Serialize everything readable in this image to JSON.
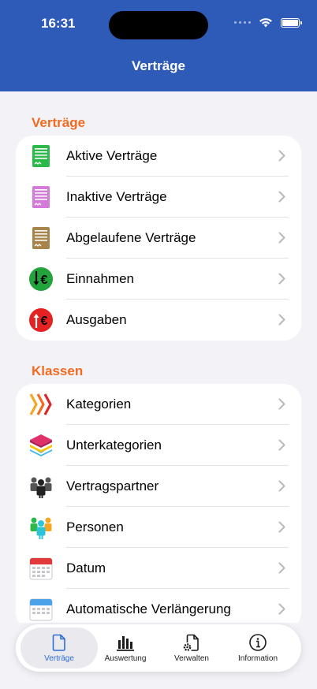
{
  "status_bar": {
    "time": "16:31"
  },
  "nav": {
    "title": "Verträge"
  },
  "sections": [
    {
      "header": "Verträge",
      "items": [
        {
          "label": "Aktive Verträge",
          "icon": "green-document-icon"
        },
        {
          "label": "Inaktive Verträge",
          "icon": "pink-document-icon"
        },
        {
          "label": "Abgelaufene Verträge",
          "icon": "brown-document-icon"
        },
        {
          "label": "Einnahmen",
          "icon": "income-euro-icon"
        },
        {
          "label": "Ausgaben",
          "icon": "expense-euro-icon"
        }
      ]
    },
    {
      "header": "Klassen",
      "items": [
        {
          "label": "Kategorien",
          "icon": "chevrons-category-icon"
        },
        {
          "label": "Unterkategorien",
          "icon": "layers-icon"
        },
        {
          "label": "Vertragspartner",
          "icon": "people-group-icon"
        },
        {
          "label": "Personen",
          "icon": "persons-icon"
        },
        {
          "label": "Datum",
          "icon": "calendar-red-icon"
        },
        {
          "label": "Automatische Verlängerung",
          "icon": "calendar-blue-icon"
        }
      ]
    }
  ],
  "tabbar": {
    "tabs": [
      {
        "label": "Verträge",
        "icon": "document-icon",
        "active": true
      },
      {
        "label": "Auswertung",
        "icon": "bar-chart-icon",
        "active": false
      },
      {
        "label": "Verwalten",
        "icon": "document-gear-icon",
        "active": false
      },
      {
        "label": "Information",
        "icon": "info-circle-icon",
        "active": false
      }
    ]
  },
  "colors": {
    "header_bg": "#2f5bb8",
    "section_header": "#f26b21",
    "active_tab": "#2f6fd6"
  }
}
